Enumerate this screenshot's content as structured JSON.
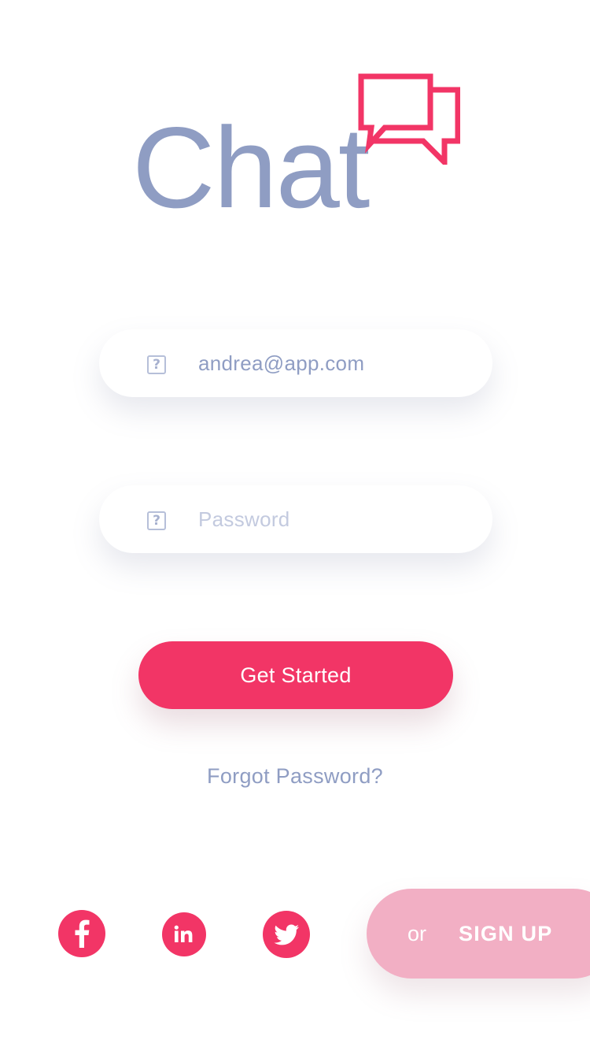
{
  "app": {
    "logo_text": "Chat",
    "logo_icon": "chat-bubbles-icon"
  },
  "login": {
    "email": {
      "value": "andrea@app.com",
      "icon": "placeholder-icon",
      "icon_glyph": "?"
    },
    "password": {
      "placeholder": "Password",
      "icon": "placeholder-icon",
      "icon_glyph": "?"
    },
    "submit_label": "Get Started",
    "forgot_label": "Forgot Password?"
  },
  "social": [
    {
      "name": "facebook-icon"
    },
    {
      "name": "linkedin-icon"
    },
    {
      "name": "twitter-icon"
    }
  ],
  "signup": {
    "or_label": "or",
    "label": "SIGN UP"
  },
  "colors": {
    "accent": "#f23566",
    "text_muted": "#8f9dc3",
    "placeholder": "#c3cadf",
    "signup_pill": "#f2afc4",
    "background": "#ffffff"
  }
}
